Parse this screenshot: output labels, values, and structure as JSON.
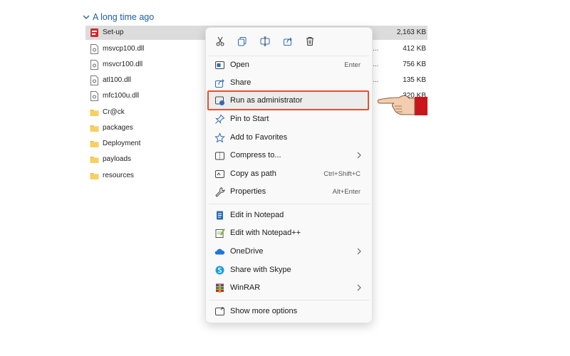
{
  "group": {
    "title": "A long time ago"
  },
  "files": [
    {
      "name": "Set-up",
      "dots": "",
      "size": "2,163 KB",
      "icon": "setup-icon"
    },
    {
      "name": "msvcp100.dll",
      "dots": "...",
      "size": "412 KB",
      "icon": "dll-file-icon"
    },
    {
      "name": "msvcr100.dll",
      "dots": "...",
      "size": "756 KB",
      "icon": "dll-file-icon"
    },
    {
      "name": "atl100.dll",
      "dots": "...",
      "size": "135 KB",
      "icon": "dll-file-icon"
    },
    {
      "name": "mfc100u.dll",
      "dots": "",
      "size": "320 KB",
      "icon": "dll-file-icon"
    },
    {
      "name": "Cr@ck",
      "dots": "",
      "size": "",
      "icon": "folder-icon"
    },
    {
      "name": "packages",
      "dots": "",
      "size": "",
      "icon": "folder-icon"
    },
    {
      "name": "Deployment",
      "dots": "",
      "size": "",
      "icon": "folder-icon"
    },
    {
      "name": "payloads",
      "dots": "",
      "size": "",
      "icon": "folder-icon"
    },
    {
      "name": "resources",
      "dots": "",
      "size": "",
      "icon": "folder-icon"
    }
  ],
  "context_menu": {
    "toolbar": [
      "cut-icon",
      "copy-icon",
      "rename-icon",
      "share-icon",
      "delete-icon"
    ],
    "items": [
      {
        "label": "Open",
        "shortcut": "Enter",
        "icon": "open-icon"
      },
      {
        "label": "Share",
        "shortcut": "",
        "icon": "share-icon"
      },
      {
        "label": "Run as administrator",
        "shortcut": "",
        "icon": "run-as-admin-icon",
        "highlighted": true
      },
      {
        "label": "Pin to Start",
        "shortcut": "",
        "icon": "pin-icon"
      },
      {
        "label": "Add to Favorites",
        "shortcut": "",
        "icon": "star-icon"
      },
      {
        "label": "Compress to...",
        "shortcut": "",
        "icon": "compress-icon",
        "submenu": true
      },
      {
        "label": "Copy as path",
        "shortcut": "Ctrl+Shift+C",
        "icon": "copy-path-icon"
      },
      {
        "label": "Properties",
        "shortcut": "Alt+Enter",
        "icon": "properties-icon"
      },
      {
        "label": "Edit in Notepad",
        "shortcut": "",
        "icon": "notepad-icon"
      },
      {
        "label": "Edit with Notepad++",
        "shortcut": "",
        "icon": "notepad-plus-plus-icon"
      },
      {
        "label": "OneDrive",
        "shortcut": "",
        "icon": "onedrive-icon",
        "submenu": true
      },
      {
        "label": "Share with Skype",
        "shortcut": "",
        "icon": "skype-icon"
      },
      {
        "label": "WinRAR",
        "shortcut": "",
        "icon": "winrar-icon",
        "submenu": true
      },
      {
        "label": "Show more options",
        "shortcut": "",
        "icon": "more-options-icon"
      }
    ]
  },
  "colors": {
    "accent": "#1a5fa8",
    "highlight_border": "#e8502c",
    "folder": "#f5c04a",
    "selected_row": "#dcdcdc"
  }
}
